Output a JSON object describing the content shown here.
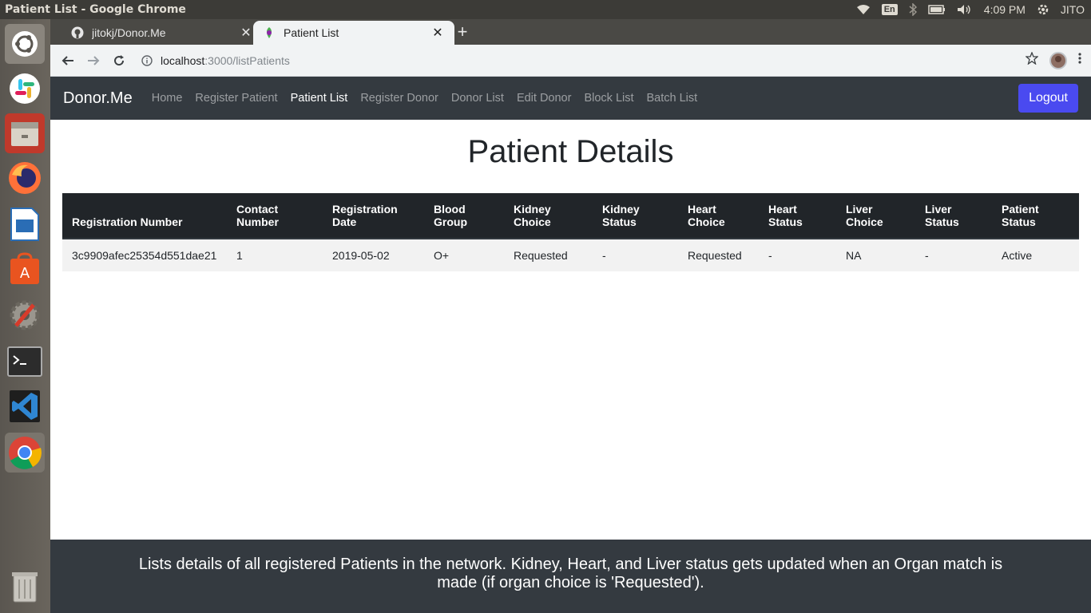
{
  "os": {
    "window_title": "Patient List - Google Chrome",
    "lang": "En",
    "time": "4:09 PM",
    "user": "JITO"
  },
  "browser": {
    "tabs": [
      {
        "title": "jitokj/Donor.Me",
        "icon": "github-icon"
      },
      {
        "title": "Patient List",
        "icon": "app-favicon"
      }
    ],
    "url_host": "localhost",
    "url_path": ":3000/listPatients"
  },
  "navbar": {
    "brand": "Donor.Me",
    "links": [
      "Home",
      "Register Patient",
      "Patient List",
      "Register Donor",
      "Donor List",
      "Edit Donor",
      "Block List",
      "Batch List"
    ],
    "active": "Patient List",
    "logout": "Logout"
  },
  "main": {
    "title": "Patient Details",
    "table": {
      "headers": [
        [
          "Registration Number",
          ""
        ],
        [
          "Contact",
          "Number"
        ],
        [
          "Registration",
          "Date"
        ],
        [
          "Blood",
          "Group"
        ],
        [
          "Kidney",
          "Choice"
        ],
        [
          "Kidney",
          "Status"
        ],
        [
          "Heart",
          "Choice"
        ],
        [
          "Heart",
          "Status"
        ],
        [
          "Liver",
          "Choice"
        ],
        [
          "Liver",
          "Status"
        ],
        [
          "Patient",
          "Status"
        ]
      ],
      "rows": [
        [
          "3c9909afec25354d551dae21",
          "1",
          "2019-05-02",
          "O+",
          "Requested",
          "-",
          "Requested",
          "-",
          "NA",
          "-",
          "Active"
        ]
      ]
    }
  },
  "footer": {
    "text": "Lists details of all registered Patients in the network. Kidney, Heart, and Liver status gets updated when an Organ match is made (if organ choice is 'Requested')."
  },
  "colors": {
    "navbar_bg": "#343a40",
    "table_head_bg": "#212529",
    "logout_bg": "#4a4af0"
  }
}
